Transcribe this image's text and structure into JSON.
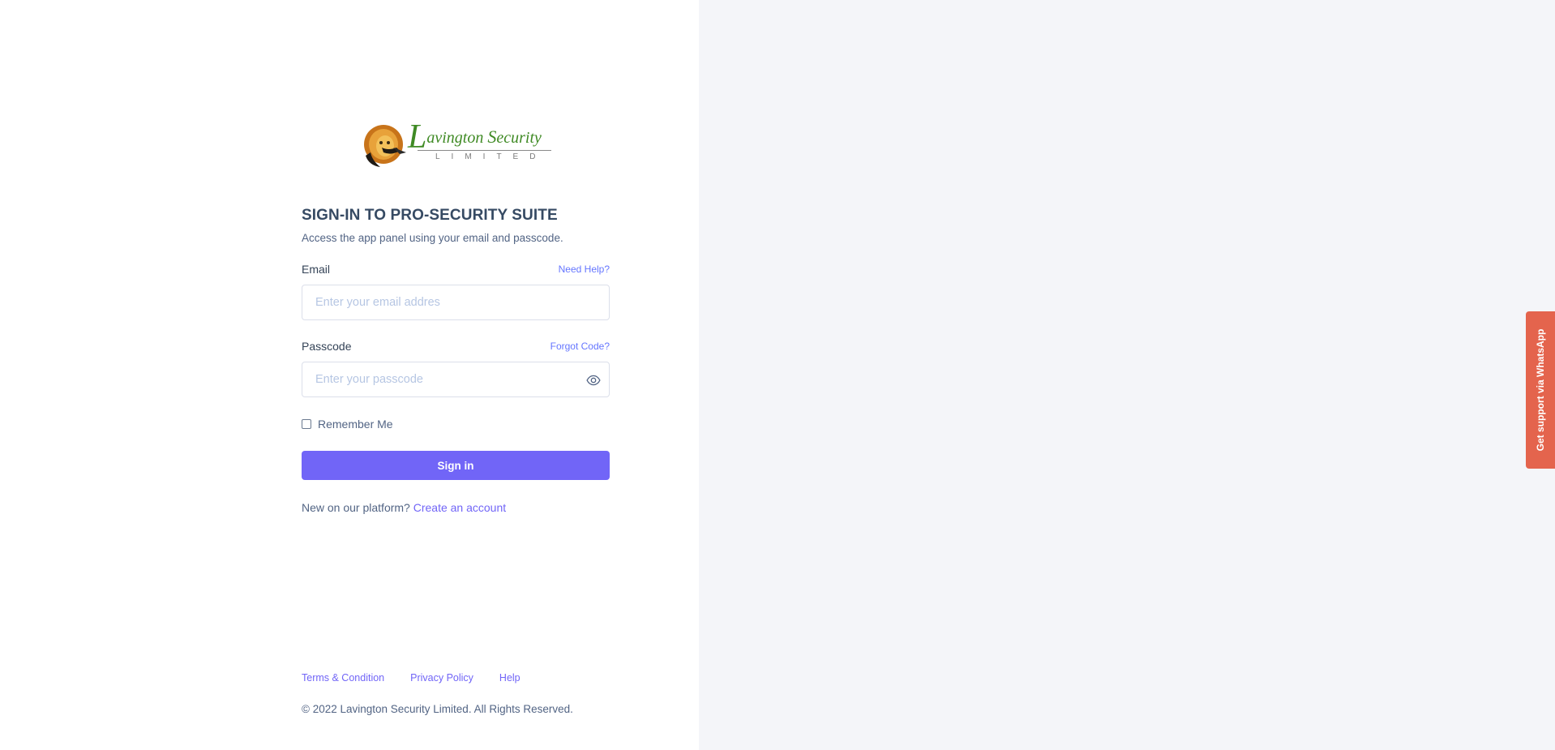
{
  "brand": {
    "name_initial": "L",
    "name_rest": "avington ",
    "name_second_initial": "S",
    "name_second_rest": "ecurity",
    "subtitle": "LIMITED",
    "colors": {
      "wordmark": "#3f8a24",
      "accent": "#7165f7",
      "whatsapp_tab": "#e4644d",
      "right_panel_bg": "#f4f5f9"
    }
  },
  "login": {
    "title": "SIGN-IN TO PRO-SECURITY SUITE",
    "subtitle": "Access the app panel using your email and passcode.",
    "email": {
      "label": "Email",
      "help_link": "Need Help?",
      "placeholder": "Enter your email addres",
      "value": ""
    },
    "passcode": {
      "label": "Passcode",
      "help_link": "Forgot Code?",
      "placeholder": "Enter your passcode",
      "value": "",
      "toggle_icon": "eye-icon"
    },
    "remember_label": "Remember Me",
    "remember_checked": false,
    "submit_label": "Sign in",
    "signup_prompt": "New on our platform?",
    "signup_link": "Create an account"
  },
  "footer": {
    "links": [
      "Terms & Condition",
      "Privacy Policy",
      "Help"
    ],
    "copyright": "© 2022 Lavington Security Limited. All Rights Reserved."
  },
  "support_tab": {
    "label": "Get support via WhatsApp"
  }
}
